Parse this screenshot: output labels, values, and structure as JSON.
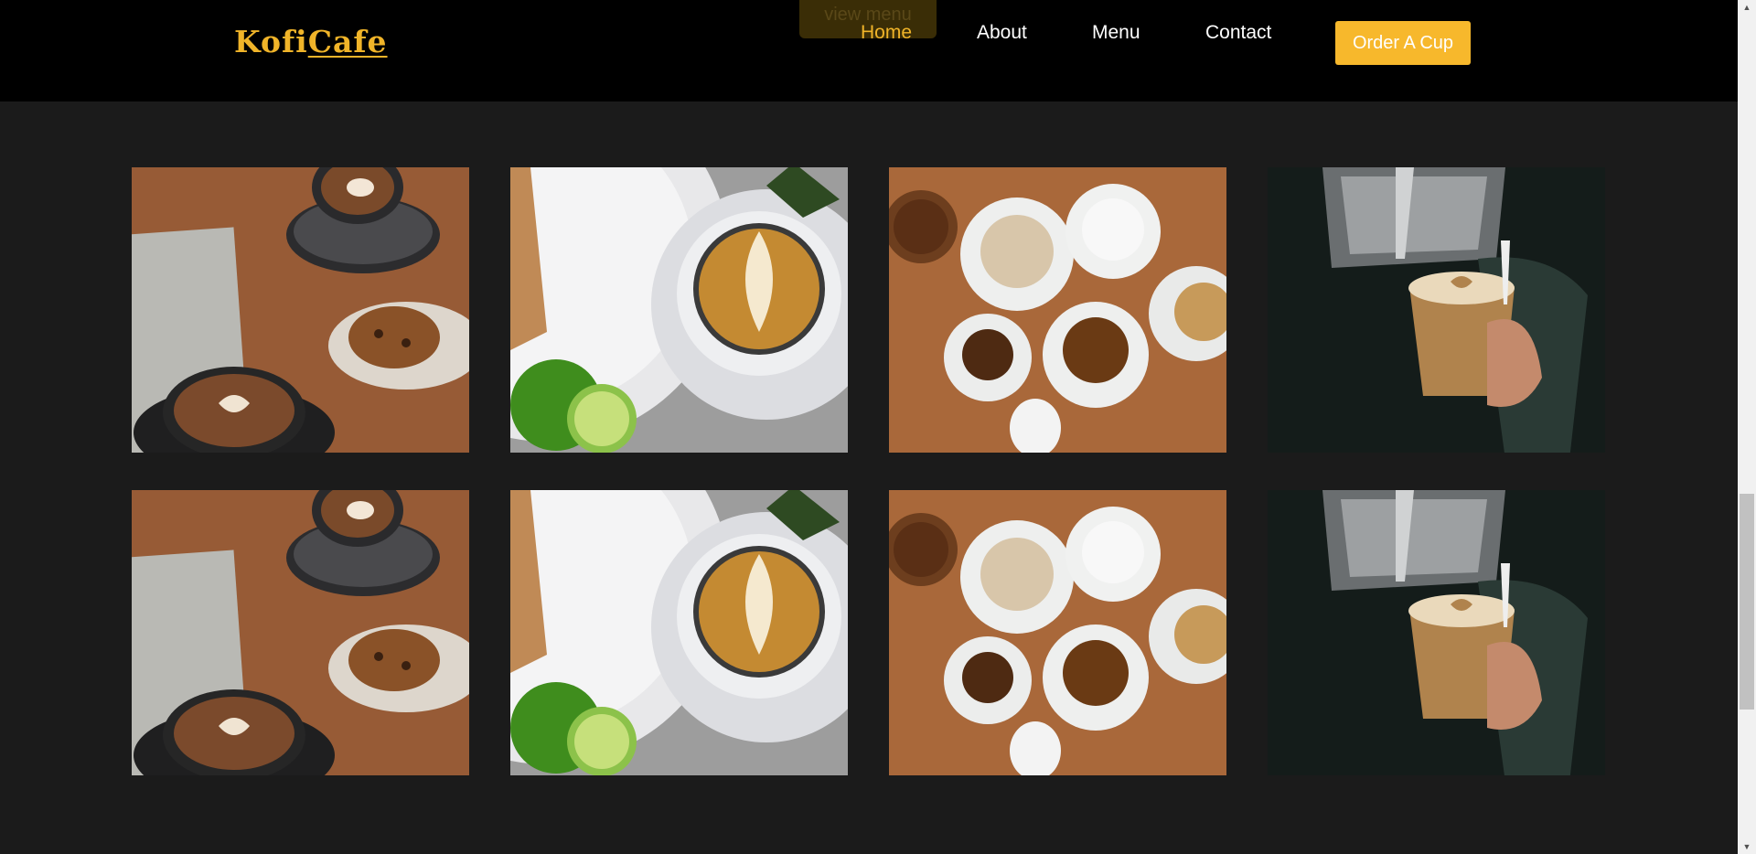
{
  "header": {
    "logo_part1": "Kofi",
    "logo_part2": "Cafe",
    "ghost_button_label": "view menu",
    "nav": [
      {
        "label": "Home",
        "active": true
      },
      {
        "label": "About",
        "active": false
      },
      {
        "label": "Menu",
        "active": false
      },
      {
        "label": "Contact",
        "active": false
      }
    ],
    "cta_label": "Order A Cup"
  },
  "gallery": {
    "images": [
      {
        "icon": "latte-cookie-photo"
      },
      {
        "icon": "latte-art-lime-photo"
      },
      {
        "icon": "coffee-cups-flatlay-photo"
      },
      {
        "icon": "barista-pour-photo"
      },
      {
        "icon": "latte-cookie-photo"
      },
      {
        "icon": "latte-art-lime-photo"
      },
      {
        "icon": "coffee-cups-flatlay-photo"
      },
      {
        "icon": "barista-pour-photo"
      }
    ]
  },
  "colors": {
    "accent": "#f0b429",
    "header_bg": "#000000",
    "page_bg": "#1b1b1b"
  }
}
